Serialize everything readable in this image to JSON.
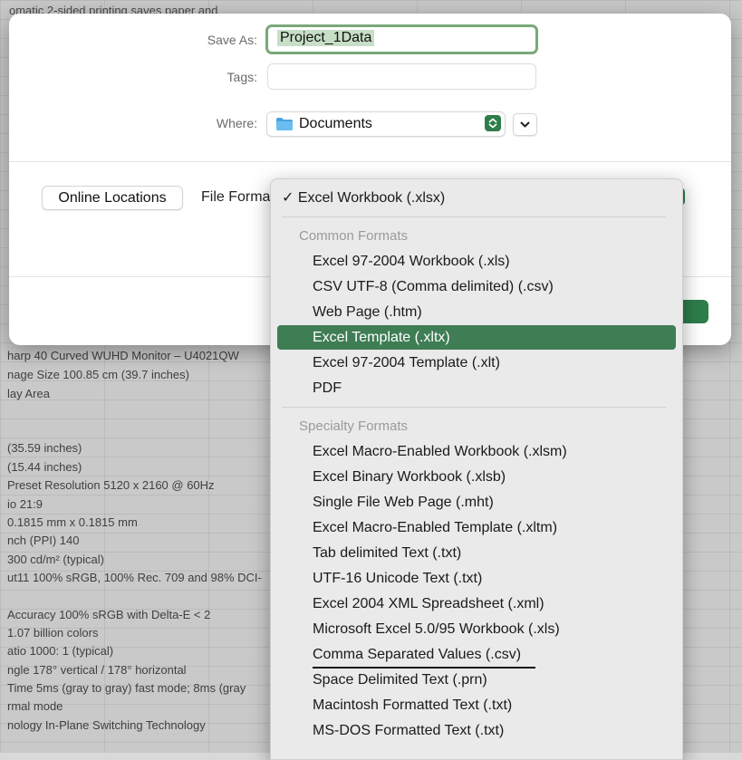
{
  "background": {
    "top_text": "omatic 2-sided printing saves paper and",
    "spec_lines": [
      "harp 40 Curved WUHD Monitor – U4021QW",
      "nage Size 100.85 cm (39.7 inches)",
      "lay Area",
      "",
      "",
      "(35.59 inches)",
      "(15.44 inches)",
      "Preset Resolution 5120 x 2160 @ 60Hz",
      "io 21:9",
      "0.1815 mm x 0.1815 mm",
      "nch (PPI) 140",
      "300 cd/m² (typical)",
      "ut11 100% sRGB, 100% Rec. 709 and 98% DCI-",
      "",
      "Accuracy 100% sRGB with Delta-E < 2",
      "1.07 billion colors",
      "atio 1000: 1 (typical)",
      "ngle 178° vertical / 178° horizontal",
      "Time 5ms (gray to gray) fast mode; 8ms (gray",
      "rmal mode",
      "nology In-Plane Switching Technology"
    ]
  },
  "dialog": {
    "save_as_label": "Save As:",
    "save_as_value": "Project_1Data",
    "tags_label": "Tags:",
    "tags_value": "",
    "where_label": "Where:",
    "where_value": "Documents",
    "online_locations_label": "Online Locations",
    "file_format_label": "File Forma"
  },
  "menu": {
    "selected": "✓ Excel Workbook (.xlsx)",
    "common_header": "Common Formats",
    "common_items": [
      "Excel 97-2004 Workbook (.xls)",
      "CSV UTF-8 (Comma delimited) (.csv)",
      "Web Page (.htm)",
      "Excel Template (.xltx)",
      "Excel 97-2004 Template (.xlt)",
      "PDF"
    ],
    "highlighted_item": "Excel Template (.xltx)",
    "specialty_header": "Specialty Formats",
    "specialty_items": [
      "Excel Macro-Enabled Workbook (.xlsm)",
      "Excel Binary Workbook (.xlsb)",
      "Single File Web Page (.mht)",
      "Excel Macro-Enabled Template (.xltm)",
      "Tab delimited Text (.txt)",
      "UTF-16 Unicode Text (.txt)",
      "Excel 2004 XML Spreadsheet (.xml)",
      "Microsoft Excel 5.0/95 Workbook (.xls)",
      "Comma Separated Values (.csv)",
      "Space Delimited Text (.prn)",
      "Macintosh Formatted Text (.txt)",
      "MS-DOS Formatted Text (.txt)"
    ]
  },
  "colors": {
    "accent_green": "#2e7d4a",
    "highlight_green": "#3f7d55",
    "focus_ring": "#7aa87a"
  }
}
